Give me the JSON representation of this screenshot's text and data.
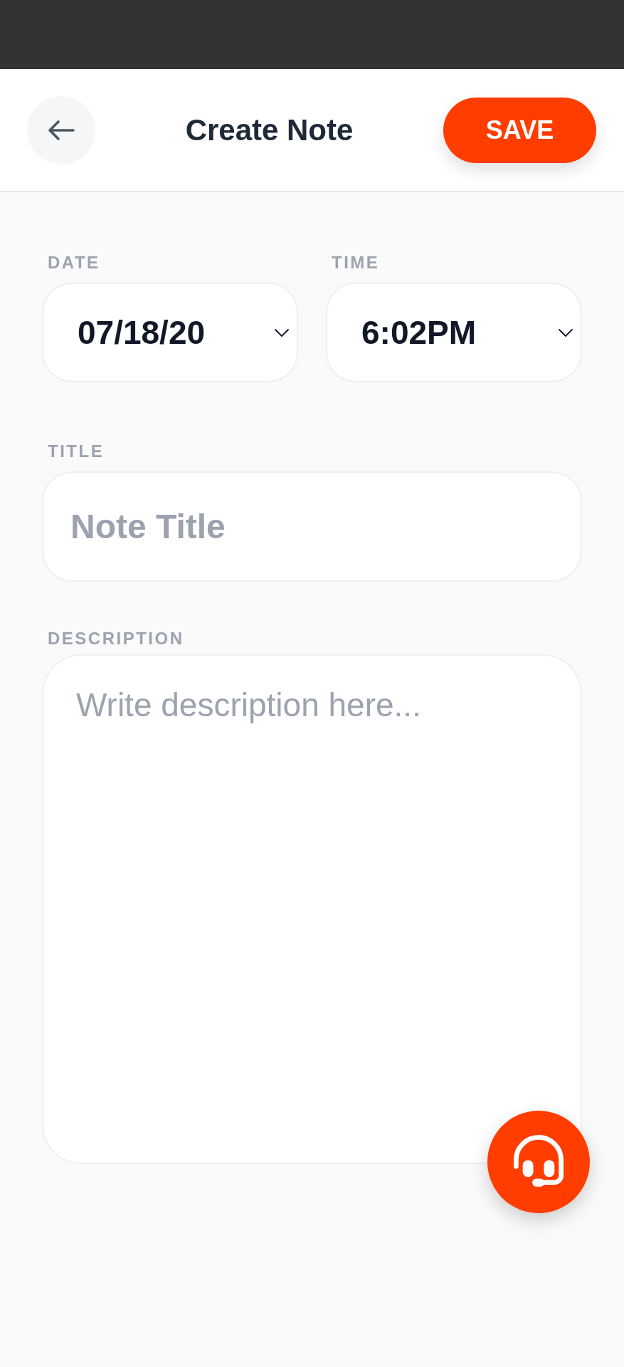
{
  "header": {
    "title": "Create Note",
    "save_label": "SAVE"
  },
  "date": {
    "label": "DATE",
    "value": "07/18/20"
  },
  "time": {
    "label": "TIME",
    "value": "6:02PM"
  },
  "note_title": {
    "label": "TITLE",
    "placeholder": "Note Title"
  },
  "description": {
    "label": "DESCRIPTION",
    "placeholder": "Write description here..."
  }
}
